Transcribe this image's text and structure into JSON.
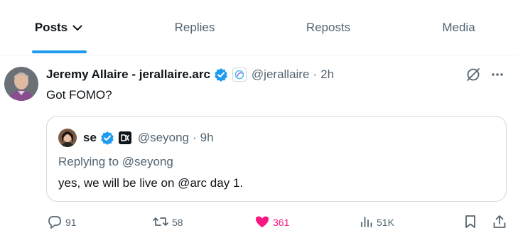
{
  "tabs": [
    {
      "label": "Posts",
      "active": true
    },
    {
      "label": "Replies",
      "active": false
    },
    {
      "label": "Reposts",
      "active": false
    },
    {
      "label": "Media",
      "active": false
    }
  ],
  "post": {
    "display_name": "Jeremy Allaire - jerallaire.arc",
    "handle": "@jerallaire",
    "separator": "·",
    "time": "2h",
    "text": "Got FOMO?",
    "verified_icon": "verified-badge-icon",
    "affiliate_icon": "arc-logo-icon"
  },
  "quote": {
    "display_name": "se",
    "handle": "@seyong",
    "separator": "·",
    "time": "9h",
    "badge_icon": "dx-badge-icon",
    "replying_to": "Replying to @seyong",
    "text": "yes, we will be live on @arc day 1."
  },
  "actions": {
    "replies": "91",
    "reposts": "58",
    "likes": "361",
    "views": "51K"
  },
  "colors": {
    "accent": "#1d9bf0",
    "like": "#f91880",
    "muted": "#536471",
    "text": "#0f1419",
    "border": "#cfd9de"
  }
}
